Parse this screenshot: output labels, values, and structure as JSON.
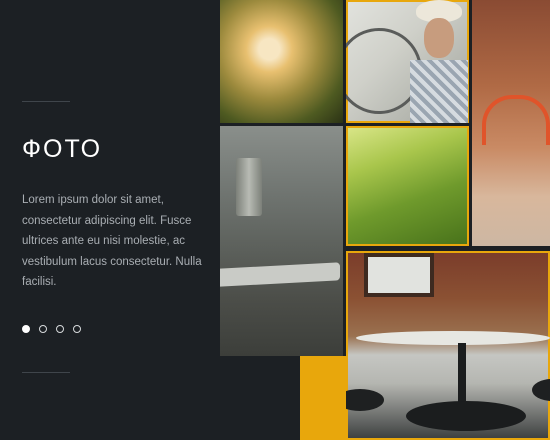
{
  "sidebar": {
    "title": "ФОТО",
    "description": "Lorem ipsum dolor sit amet, consectetur adipiscing elit. Fusce ultrices ante eu nisi molestie, ac vestibulum lacus consectetur. Nulla facilisi.",
    "pager": {
      "count": 4,
      "active_index": 0
    }
  },
  "colors": {
    "background": "#1c2024",
    "accent": "#e8a70c",
    "text_muted": "#a9aeb3",
    "title": "#ffffff"
  },
  "gallery": {
    "photos": [
      "dandelion-photo",
      "cafe-table-photo",
      "woman-with-bicycle-photo",
      "orange-chairs-photo",
      "grass-photo",
      "cafe-interior-photo"
    ]
  }
}
